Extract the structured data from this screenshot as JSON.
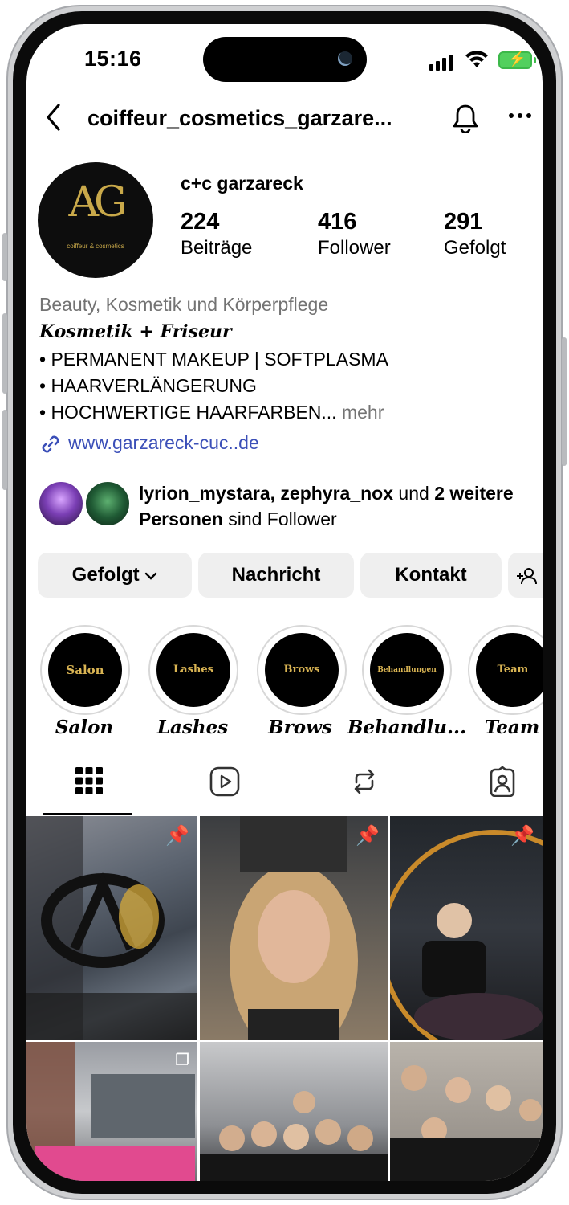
{
  "status": {
    "time": "15:16"
  },
  "header": {
    "username": "coiffeur_cosmetics_garzare..."
  },
  "profile": {
    "avatar_logo": "AG",
    "avatar_text": "coiffeur & cosmetics",
    "name": "c+c garzareck",
    "stats": [
      {
        "value": "224",
        "label": "Beiträge"
      },
      {
        "value": "416",
        "label": "Follower"
      },
      {
        "value": "291",
        "label": "Gefolgt"
      }
    ],
    "category": "Beauty, Kosmetik und Körperpflege",
    "bio_heading": "Kosmetik + Friseur",
    "bio_lines": [
      "• PERMANENT MAKEUP | SOFTPLASMA",
      "• HAARVERLÄNGERUNG",
      "• HOCHWERTIGE HAARFARBEN..."
    ],
    "more": " mehr",
    "website": "www.garzareck-cuc..de",
    "followed_by": {
      "names": "lyrion_mystara, zephyra_nox",
      "mid": " und ",
      "others": "2 weitere Personen",
      "suffix": " sind Follower"
    }
  },
  "actions": {
    "following": "Gefolgt",
    "message": "Nachricht",
    "contact": "Kontakt"
  },
  "highlights": [
    {
      "inner": "Salon",
      "label": "Salon"
    },
    {
      "inner": "Lashes",
      "label": "Lashes"
    },
    {
      "inner": "Brows",
      "label": "Brows"
    },
    {
      "inner": "Behandlungen",
      "label": "Behandlu..."
    },
    {
      "inner": "Team",
      "label": "Team"
    }
  ],
  "tabs": [
    "grid-icon",
    "reels-icon",
    "reposts-icon",
    "tagged-icon"
  ],
  "colors": {
    "link": "#3b4fb8",
    "gold": "#d9b453",
    "button_bg": "#efefef"
  }
}
